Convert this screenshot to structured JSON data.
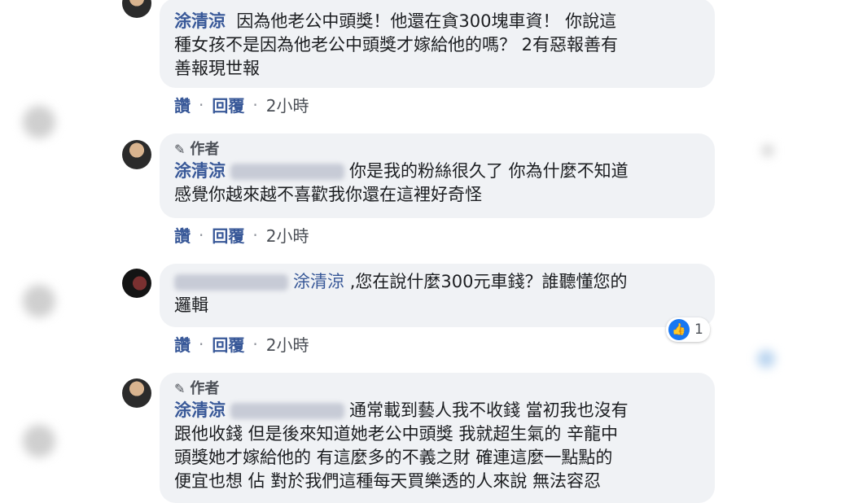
{
  "comments": [
    {
      "author_tag": "",
      "name": "涂清涼",
      "lines": [
        "因為他老公中頭獎！他還在貪300塊車資！ 你說這",
        "種女孩不是因為他老公中頭獎才嫁給他的嗎？ 2有惡報善有",
        "善報現世報"
      ],
      "like": "讚",
      "reply": "回覆",
      "time": "2小時"
    },
    {
      "author_tag": "作者",
      "name": "涂清涼",
      "lines": [
        "你是我的粉絲很久了 你為什麼不知道",
        "感覺你越來越不喜歡我你還在這裡好奇怪"
      ],
      "like": "讚",
      "reply": "回覆",
      "time": "2小時"
    },
    {
      "author_tag": "",
      "mention": "涂清涼",
      "lines": [
        ",您在說什麼300元車錢？誰聽懂您的",
        "邏輯"
      ],
      "like": "讚",
      "reply": "回覆",
      "time": "2小時",
      "reaction_count": "1"
    },
    {
      "author_tag": "作者",
      "name": "涂清涼",
      "lines": [
        "通常載到藝人我不收錢 當初我也沒有",
        "跟他收錢 但是後來知道她老公中頭獎 我就超生氣的 辛龍中",
        "頭獎她才嫁給他的 有這麼多的不義之財 確連這麼一點點的",
        "便宜也想 佔 對於我們這種每天買樂透的人來說 無法容忍"
      ]
    }
  ],
  "colors": {
    "link": "#385898",
    "bubble": "#f0f2f5",
    "like": "#1877f2"
  }
}
